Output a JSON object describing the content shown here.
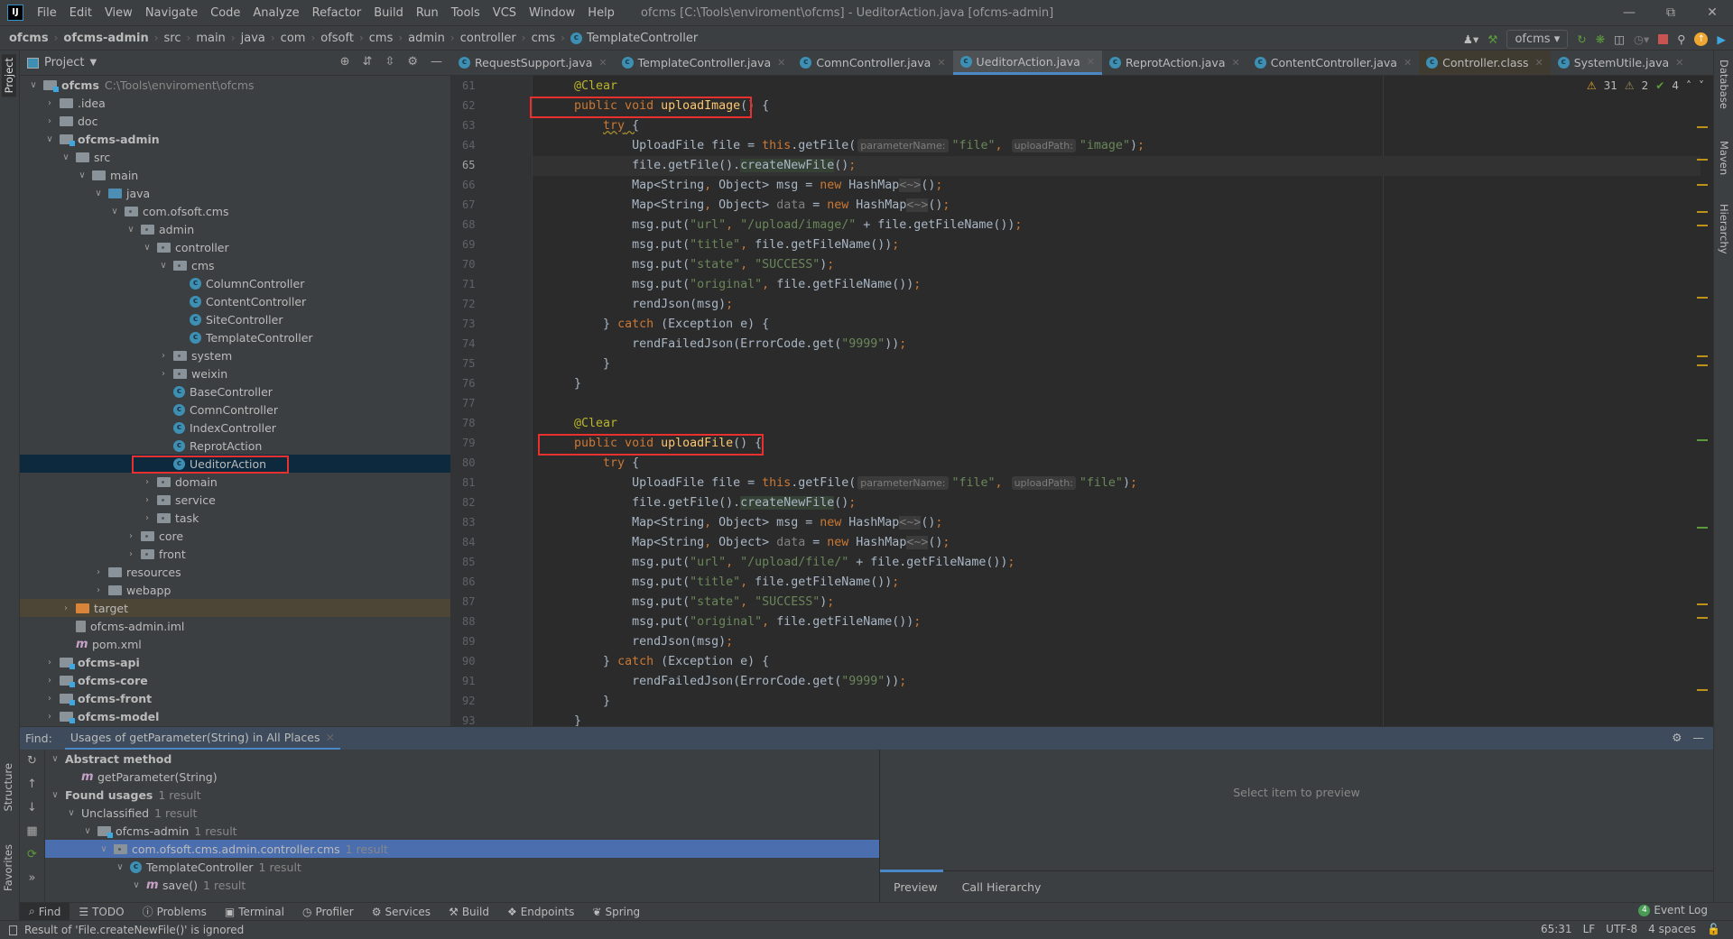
{
  "menubar": {
    "items": [
      "File",
      "Edit",
      "View",
      "Navigate",
      "Code",
      "Analyze",
      "Refactor",
      "Build",
      "Run",
      "Tools",
      "VCS",
      "Window",
      "Help"
    ],
    "window_title": "ofcms [C:\\Tools\\enviroment\\ofcms] - UeditorAction.java [ofcms-admin]",
    "logo": "IJ"
  },
  "navbar": {
    "breadcrumb": [
      "ofcms",
      "ofcms-admin",
      "src",
      "main",
      "java",
      "com",
      "ofsoft",
      "cms",
      "admin",
      "controller",
      "cms",
      "TemplateController"
    ],
    "run_config": "ofcms"
  },
  "side_left": {
    "project": "Project",
    "structure": "Structure",
    "favorites": "Favorites"
  },
  "side_right": {
    "database": "Database",
    "maven": "Maven",
    "hierarchy": "Hierarchy"
  },
  "project": {
    "title": "Project",
    "tree": [
      {
        "d": 0,
        "a": "v",
        "i": "mod",
        "n": "ofcms",
        "b": true,
        "h": "C:\\Tools\\enviroment\\ofcms"
      },
      {
        "d": 1,
        "a": ">",
        "i": "dir",
        "n": ".idea"
      },
      {
        "d": 1,
        "a": ">",
        "i": "dir",
        "n": "doc"
      },
      {
        "d": 1,
        "a": "v",
        "i": "mod",
        "n": "ofcms-admin",
        "b": true
      },
      {
        "d": 2,
        "a": "v",
        "i": "dir",
        "n": "src"
      },
      {
        "d": 3,
        "a": "v",
        "i": "dir",
        "n": "main"
      },
      {
        "d": 4,
        "a": "v",
        "i": "src",
        "n": "java"
      },
      {
        "d": 5,
        "a": "v",
        "i": "pkg",
        "n": "com.ofsoft.cms"
      },
      {
        "d": 6,
        "a": "v",
        "i": "pkg",
        "n": "admin"
      },
      {
        "d": 7,
        "a": "v",
        "i": "pkg",
        "n": "controller"
      },
      {
        "d": 8,
        "a": "v",
        "i": "pkg",
        "n": "cms"
      },
      {
        "d": 9,
        "a": "",
        "i": "class",
        "n": "ColumnController"
      },
      {
        "d": 9,
        "a": "",
        "i": "class",
        "n": "ContentController"
      },
      {
        "d": 9,
        "a": "",
        "i": "class",
        "n": "SiteController"
      },
      {
        "d": 9,
        "a": "",
        "i": "class",
        "n": "TemplateController"
      },
      {
        "d": 8,
        "a": ">",
        "i": "pkg",
        "n": "system"
      },
      {
        "d": 8,
        "a": ">",
        "i": "pkg",
        "n": "weixin"
      },
      {
        "d": 8,
        "a": "",
        "i": "class",
        "n": "BaseController"
      },
      {
        "d": 8,
        "a": "",
        "i": "class",
        "n": "ComnController"
      },
      {
        "d": 8,
        "a": "",
        "i": "class",
        "n": "IndexController"
      },
      {
        "d": 8,
        "a": "",
        "i": "class",
        "n": "ReprotAction"
      },
      {
        "d": 8,
        "a": "",
        "i": "class",
        "n": "UeditorAction",
        "sel": true
      },
      {
        "d": 7,
        "a": ">",
        "i": "pkg",
        "n": "domain"
      },
      {
        "d": 7,
        "a": ">",
        "i": "pkg",
        "n": "service"
      },
      {
        "d": 7,
        "a": ">",
        "i": "pkg",
        "n": "task"
      },
      {
        "d": 6,
        "a": ">",
        "i": "pkg",
        "n": "core"
      },
      {
        "d": 6,
        "a": ">",
        "i": "pkg",
        "n": "front"
      },
      {
        "d": 4,
        "a": ">",
        "i": "dir",
        "n": "resources"
      },
      {
        "d": 4,
        "a": ">",
        "i": "dir",
        "n": "webapp"
      },
      {
        "d": 2,
        "a": ">",
        "i": "orange",
        "n": "target",
        "tgt": true
      },
      {
        "d": 2,
        "a": "",
        "i": "file",
        "n": "ofcms-admin.iml"
      },
      {
        "d": 2,
        "a": "",
        "i": "m",
        "n": "pom.xml"
      },
      {
        "d": 1,
        "a": ">",
        "i": "mod",
        "n": "ofcms-api",
        "b": true
      },
      {
        "d": 1,
        "a": ">",
        "i": "mod",
        "n": "ofcms-core",
        "b": true
      },
      {
        "d": 1,
        "a": ">",
        "i": "mod",
        "n": "ofcms-front",
        "b": true
      },
      {
        "d": 1,
        "a": ">",
        "i": "mod",
        "n": "ofcms-model",
        "b": true
      }
    ]
  },
  "editor": {
    "tabs": [
      {
        "label": "RequestSupport.java"
      },
      {
        "label": "TemplateController.java"
      },
      {
        "label": "ComnController.java"
      },
      {
        "label": "UeditorAction.java",
        "active": true
      },
      {
        "label": "ReprotAction.java"
      },
      {
        "label": "ContentController.java"
      },
      {
        "label": "Controller.class",
        "cls": true
      },
      {
        "label": "SystemUtile.java"
      }
    ],
    "inspections": {
      "warnings": "31",
      "weak_warnings": "2",
      "typos": "4"
    },
    "current_line": 65,
    "first_line": 61,
    "lines": [
      [
        [
          "ann",
          "    @Clear"
        ]
      ],
      [
        [
          "kw",
          "    public void "
        ],
        [
          "fn",
          "uploadImage"
        ],
        [
          "",
          "() {"
        ]
      ],
      [
        [
          "",
          "        "
        ],
        [
          "kw wavy",
          "try"
        ],
        [
          "wavy",
          " {"
        ]
      ],
      [
        [
          "",
          "            UploadFile file = "
        ],
        [
          "kw",
          "this"
        ],
        [
          "",
          ".getFile("
        ],
        [
          "hint",
          "parameterName:"
        ],
        [
          "str",
          "\"file\""
        ],
        [
          "kw",
          ", "
        ],
        [
          "hint",
          "uploadPath:"
        ],
        [
          "str",
          "\"image\""
        ],
        [
          "",
          ")"
        ],
        [
          "kw",
          ";"
        ]
      ],
      [
        [
          "",
          "            file.getFile()."
        ],
        [
          "hl",
          "createNewFile"
        ],
        [
          "",
          "()"
        ],
        [
          "kw",
          ";"
        ]
      ],
      [
        [
          "",
          "            Map<String"
        ],
        [
          "kw",
          ", "
        ],
        [
          "",
          "Object> msg = "
        ],
        [
          "kw",
          "new "
        ],
        [
          "",
          "HashMap"
        ],
        [
          "dia",
          "<~>"
        ],
        [
          "",
          "()"
        ],
        [
          "kw",
          ";"
        ]
      ],
      [
        [
          "",
          "            Map<String"
        ],
        [
          "kw",
          ", "
        ],
        [
          "",
          "Object> "
        ],
        [
          "gr",
          "data"
        ],
        [
          "",
          " = "
        ],
        [
          "kw",
          "new "
        ],
        [
          "",
          "HashMap"
        ],
        [
          "dia",
          "<~>"
        ],
        [
          "",
          "()"
        ],
        [
          "kw",
          ";"
        ]
      ],
      [
        [
          "",
          "            msg.put("
        ],
        [
          "str",
          "\"url\""
        ],
        [
          "kw",
          ", "
        ],
        [
          "str",
          "\"/upload/image/\""
        ],
        [
          "",
          " + file.getFileName())"
        ],
        [
          "kw",
          ";"
        ]
      ],
      [
        [
          "",
          "            msg.put("
        ],
        [
          "str",
          "\"title\""
        ],
        [
          "kw",
          ", "
        ],
        [
          "",
          "file.getFileName())"
        ],
        [
          "kw",
          ";"
        ]
      ],
      [
        [
          "",
          "            msg.put("
        ],
        [
          "str",
          "\"state\""
        ],
        [
          "kw",
          ", "
        ],
        [
          "str",
          "\"SUCCESS\""
        ],
        [
          "",
          ")"
        ],
        [
          "kw",
          ";"
        ]
      ],
      [
        [
          "",
          "            msg.put("
        ],
        [
          "str",
          "\"original\""
        ],
        [
          "kw",
          ", "
        ],
        [
          "",
          "file.getFileName())"
        ],
        [
          "kw",
          ";"
        ]
      ],
      [
        [
          "",
          "            rendJson(msg)"
        ],
        [
          "kw",
          ";"
        ]
      ],
      [
        [
          "",
          "        } "
        ],
        [
          "kw",
          "catch"
        ],
        [
          "",
          " (Exception e) {"
        ]
      ],
      [
        [
          "",
          "            rendFailedJson(ErrorCode.get("
        ],
        [
          "str",
          "\"9999\""
        ],
        [
          "",
          "))"
        ],
        [
          "kw",
          ";"
        ]
      ],
      [
        [
          "",
          "        }"
        ]
      ],
      [
        [
          "",
          "    }"
        ]
      ],
      [
        [
          "",
          ""
        ]
      ],
      [
        [
          "ann",
          "    @Clear"
        ]
      ],
      [
        [
          "kw",
          "    public void "
        ],
        [
          "fn",
          "uploadFile"
        ],
        [
          "",
          "() {"
        ]
      ],
      [
        [
          "",
          "        "
        ],
        [
          "kw",
          "try"
        ],
        [
          "",
          " {"
        ]
      ],
      [
        [
          "",
          "            UploadFile file = "
        ],
        [
          "kw",
          "this"
        ],
        [
          "",
          ".getFile("
        ],
        [
          "hint",
          "parameterName:"
        ],
        [
          "str",
          "\"file\""
        ],
        [
          "kw",
          ", "
        ],
        [
          "hint",
          "uploadPath:"
        ],
        [
          "str",
          "\"file\""
        ],
        [
          "",
          ")"
        ],
        [
          "kw",
          ";"
        ]
      ],
      [
        [
          "",
          "            file.getFile()."
        ],
        [
          "hl",
          "createNewFile"
        ],
        [
          "",
          "()"
        ],
        [
          "kw",
          ";"
        ]
      ],
      [
        [
          "",
          "            Map<String"
        ],
        [
          "kw",
          ", "
        ],
        [
          "",
          "Object> msg = "
        ],
        [
          "kw",
          "new "
        ],
        [
          "",
          "HashMap"
        ],
        [
          "dia",
          "<~>"
        ],
        [
          "",
          "()"
        ],
        [
          "kw",
          ";"
        ]
      ],
      [
        [
          "",
          "            Map<String"
        ],
        [
          "kw",
          ", "
        ],
        [
          "",
          "Object> "
        ],
        [
          "gr",
          "data"
        ],
        [
          "",
          " = "
        ],
        [
          "kw",
          "new "
        ],
        [
          "",
          "HashMap"
        ],
        [
          "dia",
          "<~>"
        ],
        [
          "",
          "()"
        ],
        [
          "kw",
          ";"
        ]
      ],
      [
        [
          "",
          "            msg.put("
        ],
        [
          "str",
          "\"url\""
        ],
        [
          "kw",
          ", "
        ],
        [
          "str",
          "\"/upload/file/\""
        ],
        [
          "",
          " + file.getFileName())"
        ],
        [
          "kw",
          ";"
        ]
      ],
      [
        [
          "",
          "            msg.put("
        ],
        [
          "str",
          "\"title\""
        ],
        [
          "kw",
          ", "
        ],
        [
          "",
          "file.getFileName())"
        ],
        [
          "kw",
          ";"
        ]
      ],
      [
        [
          "",
          "            msg.put("
        ],
        [
          "str",
          "\"state\""
        ],
        [
          "kw",
          ", "
        ],
        [
          "str",
          "\"SUCCESS\""
        ],
        [
          "",
          ")"
        ],
        [
          "kw",
          ";"
        ]
      ],
      [
        [
          "",
          "            msg.put("
        ],
        [
          "str",
          "\"original\""
        ],
        [
          "kw",
          ", "
        ],
        [
          "",
          "file.getFileName())"
        ],
        [
          "kw",
          ";"
        ]
      ],
      [
        [
          "",
          "            rendJson(msg)"
        ],
        [
          "kw",
          ";"
        ]
      ],
      [
        [
          "",
          "        } "
        ],
        [
          "kw",
          "catch"
        ],
        [
          "",
          " (Exception e) {"
        ]
      ],
      [
        [
          "",
          "            rendFailedJson(ErrorCode.get("
        ],
        [
          "str",
          "\"9999\""
        ],
        [
          "",
          "))"
        ],
        [
          "kw",
          ";"
        ]
      ],
      [
        [
          "",
          "        }"
        ]
      ],
      [
        [
          "",
          "    }"
        ]
      ]
    ]
  },
  "find": {
    "label": "Find:",
    "tab": "Usages of getParameter(String) in All Places",
    "rows": [
      {
        "d": 0,
        "a": "v",
        "n": "Abstract method",
        "b": true
      },
      {
        "d": 1,
        "a": "",
        "i": "m",
        "n": "getParameter(String)"
      },
      {
        "d": 0,
        "a": "v",
        "n": "Found usages",
        "b": true,
        "h": "1 result"
      },
      {
        "d": 1,
        "a": "v",
        "n": "Unclassified",
        "h": "1 result"
      },
      {
        "d": 2,
        "a": "v",
        "i": "mod",
        "n": "ofcms-admin",
        "h": "1 result"
      },
      {
        "d": 3,
        "a": "v",
        "i": "pkg",
        "n": "com.ofsoft.cms.admin.controller.cms",
        "h": "1 result",
        "sel": true
      },
      {
        "d": 4,
        "a": "v",
        "i": "class",
        "n": "TemplateController",
        "h": "1 result"
      },
      {
        "d": 5,
        "a": "v",
        "i": "m",
        "n": "save()",
        "h": "1 result"
      }
    ],
    "preview_empty": "Select item to preview",
    "preview_tabs": [
      "Preview",
      "Call Hierarchy"
    ]
  },
  "toolwindows": [
    "Find",
    "TODO",
    "Problems",
    "Terminal",
    "Profiler",
    "Services",
    "Build",
    "Endpoints",
    "Spring"
  ],
  "event_log": {
    "label": "Event Log",
    "count": "4"
  },
  "status": {
    "message": "Result of 'File.createNewFile()' is ignored",
    "position": "65:31",
    "line_sep": "LF",
    "encoding": "UTF-8",
    "indent": "4 spaces"
  },
  "colors": {
    "keyword": "#cc7832",
    "string": "#6a8759",
    "annotation": "#bbb529",
    "method": "#ffc66d",
    "highlight_box": "#e8302f",
    "selection": "#4b6eaf"
  }
}
